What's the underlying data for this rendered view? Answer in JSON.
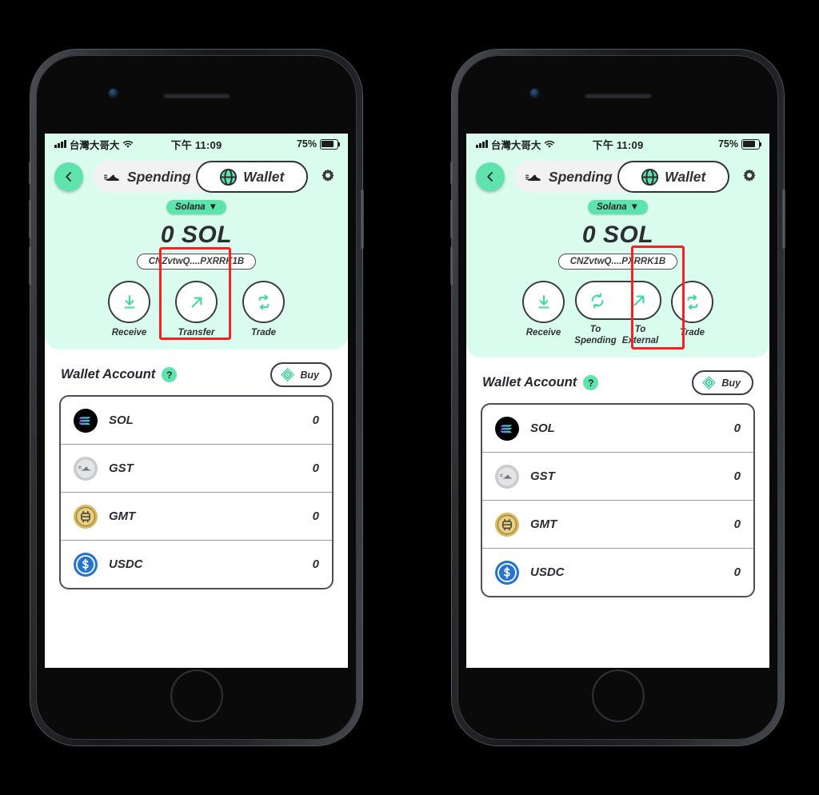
{
  "page": {
    "background": "#000000"
  },
  "theme": {
    "mint_panel": "#d9fcef",
    "accent_green": "#5fe3ad",
    "dark": "#2b2d31",
    "highlight_red": "#fc1f1f"
  },
  "status_bar": {
    "carrier": "台灣大哥大",
    "time": "下午 11:09",
    "battery_percent": "75%",
    "signal_icon": "signal-bars-icon",
    "wifi_icon": "wifi-icon",
    "battery_icon": "battery-icon"
  },
  "header": {
    "back_icon": "chevron-left-icon",
    "settings_icon": "gear-icon",
    "tabs": [
      {
        "label": "Spending",
        "icon": "sneaker-icon",
        "active": false
      },
      {
        "label": "Wallet",
        "icon": "globe-icon",
        "active": true
      }
    ]
  },
  "wallet": {
    "chain_label": "Solana",
    "chain_caret": "▼",
    "balance": "0 SOL",
    "address": "CNZvtwQ....PXRRK1B"
  },
  "actions_left": [
    {
      "label": "Receive",
      "icon": "download-arrow-icon",
      "highlighted": false
    },
    {
      "label": "Transfer",
      "icon": "arrow-up-right-icon",
      "highlighted": true
    },
    {
      "label": "Trade",
      "icon": "swap-repeat-icon",
      "highlighted": false
    }
  ],
  "actions_right": {
    "receive": {
      "label": "Receive",
      "icon": "download-arrow-icon"
    },
    "to_spending": {
      "label_line1": "To",
      "label_line2": "Spending",
      "icon": "refresh-circle-icon"
    },
    "to_external": {
      "label_line1": "To",
      "label_line2": "External",
      "icon": "arrow-up-right-icon",
      "highlighted": true
    },
    "trade": {
      "label": "Trade",
      "icon": "swap-repeat-icon"
    }
  },
  "account": {
    "title": "Wallet Account",
    "help_badge": "?",
    "buy_label": "Buy",
    "buy_icon": "diamond-token-icon"
  },
  "tokens": [
    {
      "symbol": "SOL",
      "amount": "0",
      "icon": "solana-coin-icon"
    },
    {
      "symbol": "GST",
      "amount": "0",
      "icon": "gst-coin-icon"
    },
    {
      "symbol": "GMT",
      "amount": "0",
      "icon": "gmt-coin-icon"
    },
    {
      "symbol": "USDC",
      "amount": "0",
      "icon": "usdc-coin-icon"
    }
  ]
}
